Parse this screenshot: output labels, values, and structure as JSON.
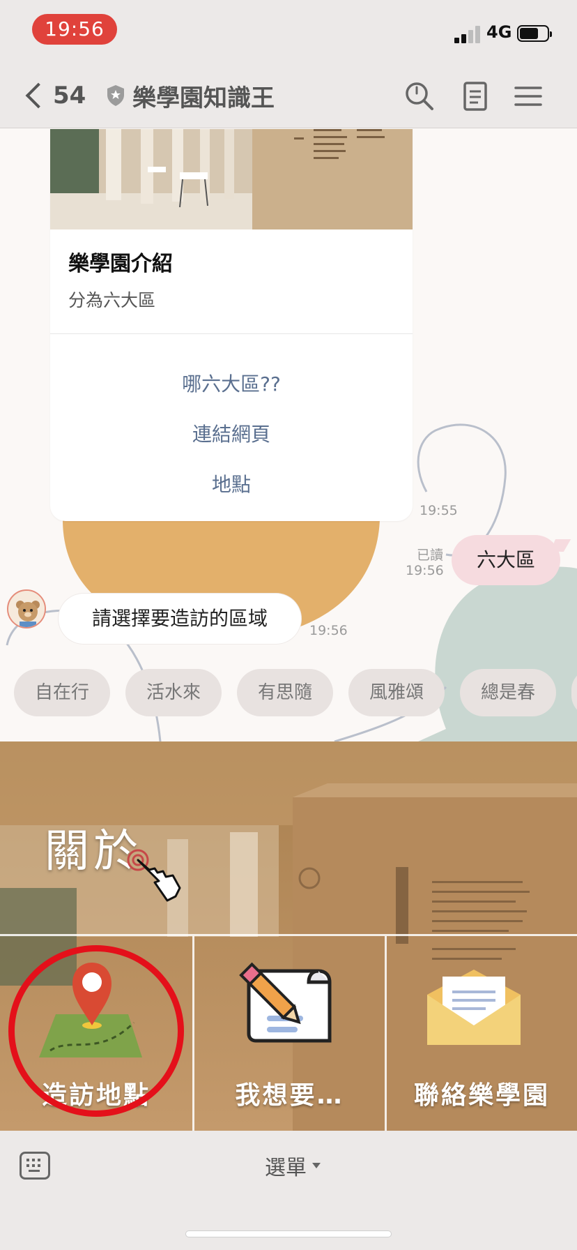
{
  "status_bar": {
    "time": "19:56",
    "network": "4G"
  },
  "nav": {
    "back_count": "54",
    "title": "樂學園知識王"
  },
  "card": {
    "title": "樂學園介紹",
    "subtitle": "分為六大區",
    "actions": [
      "哪六大區??",
      "連結網頁",
      "地點"
    ],
    "time": "19:55"
  },
  "outgoing": {
    "text": "六大區",
    "read_label": "已讀",
    "time": "19:56"
  },
  "incoming": {
    "text": "請選擇要造訪的區域",
    "time": "19:56"
  },
  "quick_replies": [
    "自在行",
    "活水來",
    "有思隨",
    "風雅頌",
    "總是春"
  ],
  "rich_menu": {
    "about_label": "關於",
    "items": [
      {
        "label": "造訪地點",
        "icon": "map-pin-icon"
      },
      {
        "label": "我想要…",
        "icon": "pencil-note-icon"
      },
      {
        "label": "聯絡樂學園",
        "icon": "envelope-icon"
      }
    ],
    "highlighted_item": "造訪地點",
    "highlight_color": "#e4101a"
  },
  "bottom_bar": {
    "menu_label": "選單"
  },
  "colors": {
    "time_pill": "#e0423b",
    "outgoing_bubble": "#f6dbdf",
    "link": "#5a6f8f"
  }
}
